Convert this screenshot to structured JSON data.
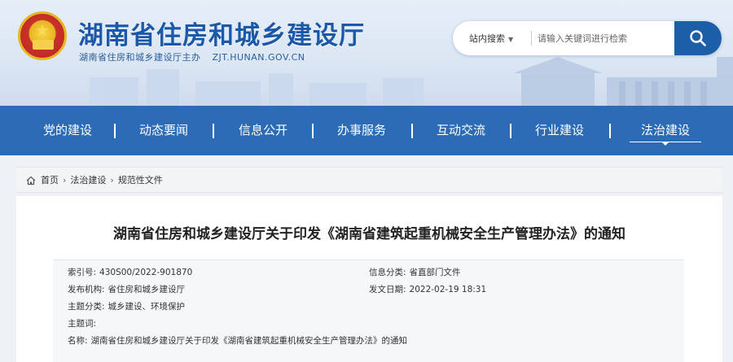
{
  "header": {
    "title": "湖南省住房和城乡建设厅",
    "host_label": "湖南省住房和城乡建设厅主办",
    "domain": "ZJT.HUNAN.GOV.CN"
  },
  "search": {
    "scope_label": "站内搜索",
    "placeholder": "请输入关键词进行检索",
    "button_icon": "search-icon"
  },
  "nav": {
    "items": [
      {
        "label": "党的建设"
      },
      {
        "label": "动态要闻"
      },
      {
        "label": "信息公开"
      },
      {
        "label": "办事服务"
      },
      {
        "label": "互动交流"
      },
      {
        "label": "行业建设"
      },
      {
        "label": "法治建设",
        "active": true
      }
    ]
  },
  "breadcrumb": {
    "items": [
      "首页",
      "法治建设",
      "规范性文件"
    ]
  },
  "article": {
    "title": "湖南省住房和城乡建设厅关于印发《湖南省建筑起重机械安全生产管理办法》的通知",
    "meta": {
      "index_label": "索引号:",
      "index_value": "430S00/2022-901870",
      "category_label": "信息分类:",
      "category_value": "省直部门文件",
      "publisher_label": "发布机构:",
      "publisher_value": "省住房和城乡建设厅",
      "date_label": "发文日期:",
      "date_value": "2022-02-19 18:31",
      "topic_label": "主题分类:",
      "topic_value": "城乡建设、环境保护",
      "keywords_label": "主题词:",
      "keywords_value": "",
      "name_label": "名称:",
      "name_value": "湖南省住房和城乡建设厅关于印发《湖南省建筑起重机械安全生产管理办法》的通知"
    }
  },
  "colors": {
    "nav_bg": "#2c6bb5",
    "title_blue": "#1c58a8",
    "search_btn": "#1c5ea8"
  }
}
